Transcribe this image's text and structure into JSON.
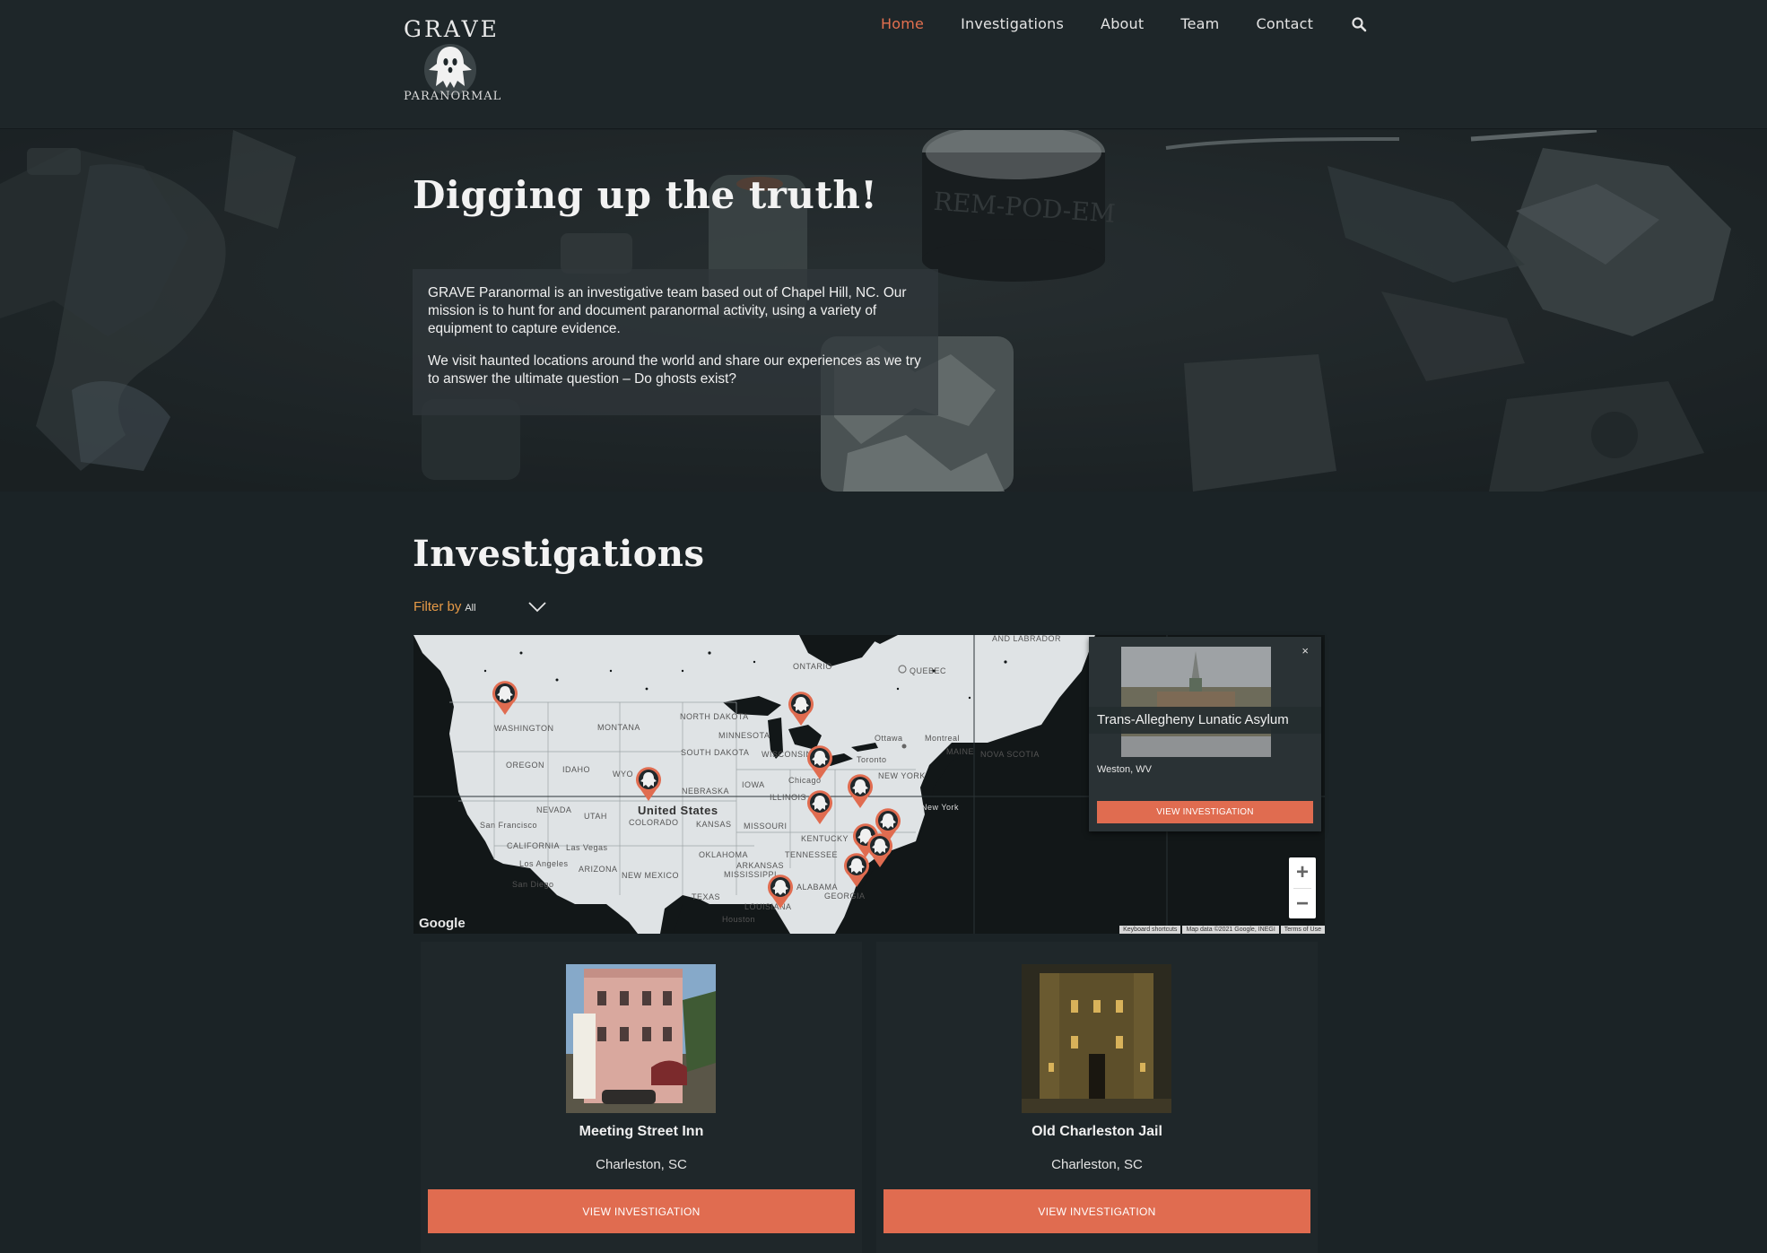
{
  "brand": {
    "logo_top": "GRAVE",
    "logo_bottom": "PARANORMAL"
  },
  "nav": {
    "items": [
      {
        "label": "Home",
        "active": true
      },
      {
        "label": "Investigations",
        "active": false
      },
      {
        "label": "About",
        "active": false
      },
      {
        "label": "Team",
        "active": false
      },
      {
        "label": "Contact",
        "active": false
      }
    ],
    "search_icon": "search-icon"
  },
  "hero": {
    "title": "Digging up the truth!",
    "paragraph1": "GRAVE Paranormal is an investigative team based out of Chapel Hill, NC. Our mission is to hunt for and document paranormal activity, using a variety of equipment to capture evidence.",
    "paragraph2": "We visit haunted locations around the world and share our experiences as we try to answer the ultimate question – Do ghosts exist?"
  },
  "investigations": {
    "title": "Investigations",
    "filter_label": "Filter by",
    "filter_value": "All"
  },
  "map": {
    "labels": {
      "country": "United States",
      "washington": "WASHINGTON",
      "oregon": "OREGON",
      "montana": "MONTANA",
      "idaho": "IDAHO",
      "nevada": "NEVADA",
      "california": "CALIFORNIA",
      "utah": "UTAH",
      "arizona": "ARIZONA",
      "colorado": "COLORADO",
      "new_mexico": "NEW MEXICO",
      "texas": "TEXAS",
      "north_dakota": "NORTH DAKOTA",
      "south_dakota": "SOUTH DAKOTA",
      "nebraska": "NEBRASKA",
      "kansas": "KANSAS",
      "oklahoma": "OKLAHOMA",
      "minnesota": "MINNESOTA",
      "iowa": "IOWA",
      "missouri": "MISSOURI",
      "arkansas": "ARKANSAS",
      "wisconsin": "WISCONSIN",
      "illinois": "ILLINOIS",
      "kentucky": "KENTUCKY",
      "tennessee": "TENNESSEE",
      "ontario": "ONTARIO",
      "quebec": "QUEBEC",
      "maine": "MAINE",
      "nova_scotia": "NOVA SCOTIA",
      "new_york": "NEW YORK",
      "ottawa": "Ottawa",
      "montreal": "Montreal",
      "toronto": "Toronto",
      "chicago": "Chicago",
      "new_york_city": "New York",
      "houston": "Houston",
      "san_francisco": "San Francisco",
      "los_angeles": "Los Angeles",
      "san_diego": "San Diego",
      "las_vegas": "Las Vegas",
      "labrador": "AND LABRADOR",
      "wy": "WYO",
      "louisiana": "LOUISIANA",
      "georgia": "GEORGIA",
      "alabama": "ALABAMA",
      "mississippi": "MISSISSIPPI"
    },
    "google": "Google",
    "footer": [
      "Keyboard shortcuts",
      "Map data ©2021 Google, INEGI",
      "Terms of Use"
    ],
    "zoom_in": "+",
    "zoom_out": "−",
    "popup": {
      "title": "Trans-Allegheny Lunatic Asylum",
      "location": "Weston, WV",
      "button": "VIEW INVESTIGATION",
      "close": "×"
    }
  },
  "cards": [
    {
      "title": "Meeting Street Inn",
      "location": "Charleston, SC",
      "button": "VIEW INVESTIGATION"
    },
    {
      "title": "Old Charleston Jail",
      "location": "Charleston, SC",
      "button": "VIEW INVESTIGATION"
    }
  ],
  "colors": {
    "accent": "#e06c50",
    "nav_active": "#e3704f",
    "filter_label": "#e79a47",
    "background": "#1b2326"
  }
}
